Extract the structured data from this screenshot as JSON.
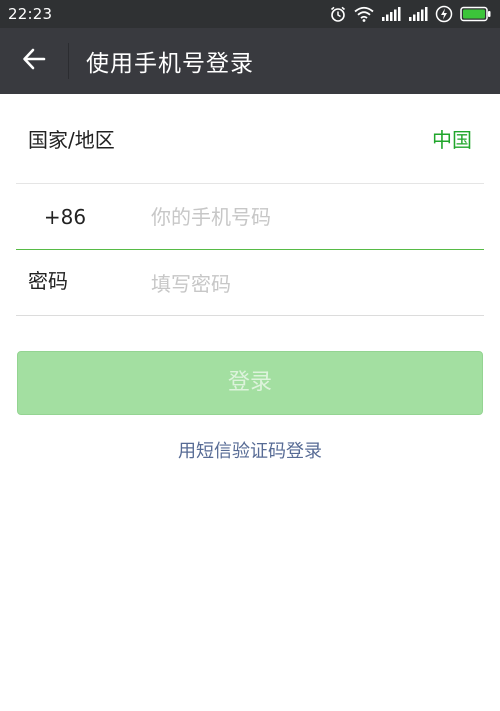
{
  "status_bar": {
    "time": "22:23",
    "icons": [
      "alarm-icon",
      "wifi-icon",
      "signal-icon",
      "signal-icon",
      "charging-icon",
      "battery-icon"
    ],
    "battery_level": 1.0
  },
  "app_bar": {
    "title": "使用手机号登录",
    "back_icon": "arrow-left-icon",
    "background": "#393a3f"
  },
  "form": {
    "country_label": "国家/地区",
    "country_value": "中国",
    "phone_code": "+86",
    "phone_placeholder": "你的手机号码",
    "phone_value": "",
    "password_label": "密码",
    "password_placeholder": "填写密码",
    "password_value": ""
  },
  "actions": {
    "login_label": "登录",
    "sms_login_label": "用短信验证码登录"
  },
  "colors": {
    "accent_green": "#20a62b",
    "active_underline": "#57bb46",
    "disabled_button": "#a3dfa1",
    "link": "#576b95"
  }
}
